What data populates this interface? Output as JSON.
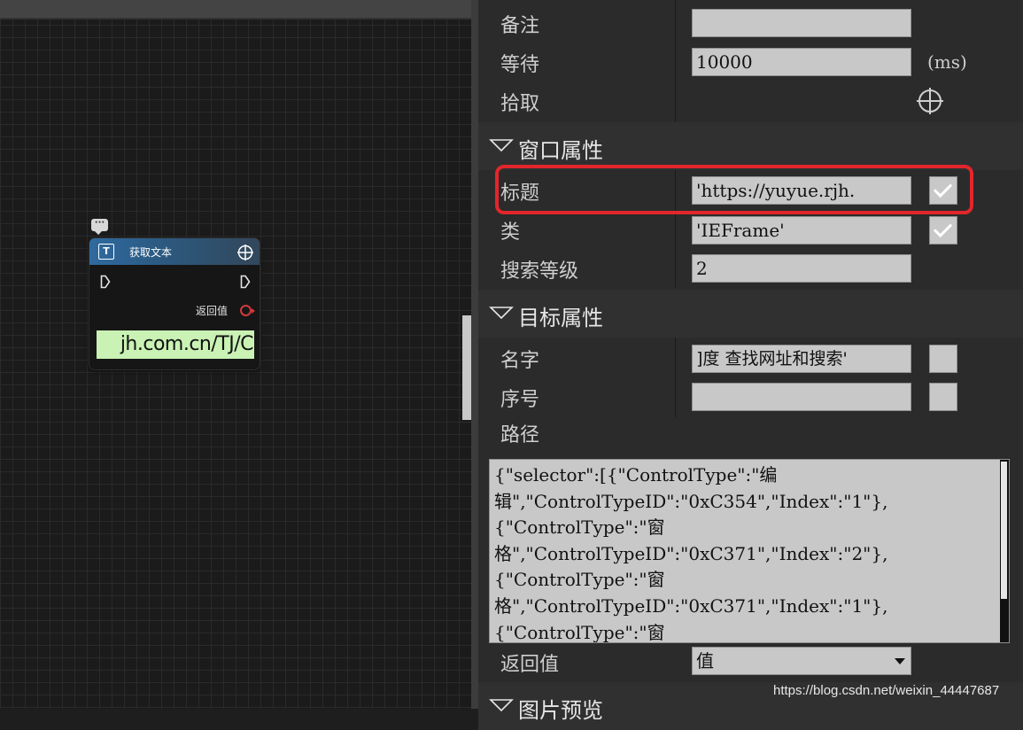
{
  "node": {
    "title": "获取文本",
    "type_icon": "text-icon",
    "return_label": "返回值",
    "preview_text": "jh.com.cn/TJ/C"
  },
  "props": {
    "remark_label": "备注",
    "remark_value": "",
    "wait_label": "等待",
    "wait_value": "10000",
    "wait_unit": "(ms)",
    "pick_label": "拾取",
    "window_section": "窗口属性",
    "title_label": "标题",
    "title_value": "'https://yuyue.rjh.",
    "title_checked": true,
    "class_label": "类",
    "class_value": "'IEFrame'",
    "class_checked": true,
    "search_level_label": "搜索等级",
    "search_level_value": "2",
    "target_section": "目标属性",
    "name_label": "名字",
    "name_value": "]度 查找网址和搜索'",
    "name_checked": false,
    "index_label": "序号",
    "index_value": "",
    "index_checked": false,
    "path_label": "路径",
    "path_value": "{\"selector\":[{\"ControlType\":\"编\n辑\",\"ControlTypeID\":\"0xC354\",\"Index\":\"1\"},\n{\"ControlType\":\"窗\n格\",\"ControlTypeID\":\"0xC371\",\"Index\":\"2\"},\n{\"ControlType\":\"窗\n格\",\"ControlTypeID\":\"0xC371\",\"Index\":\"1\"},\n{\"ControlType\":\"窗",
    "return_label": "返回值",
    "return_value": "值",
    "image_section": "图片预览"
  },
  "watermark": "https://blog.csdn.net/weixin_44447687",
  "colors": {
    "highlight": "#e2262b",
    "node_header": "#2f6aa0",
    "preview_bg": "#c9f2b4",
    "return_pin": "#d03a3a"
  }
}
